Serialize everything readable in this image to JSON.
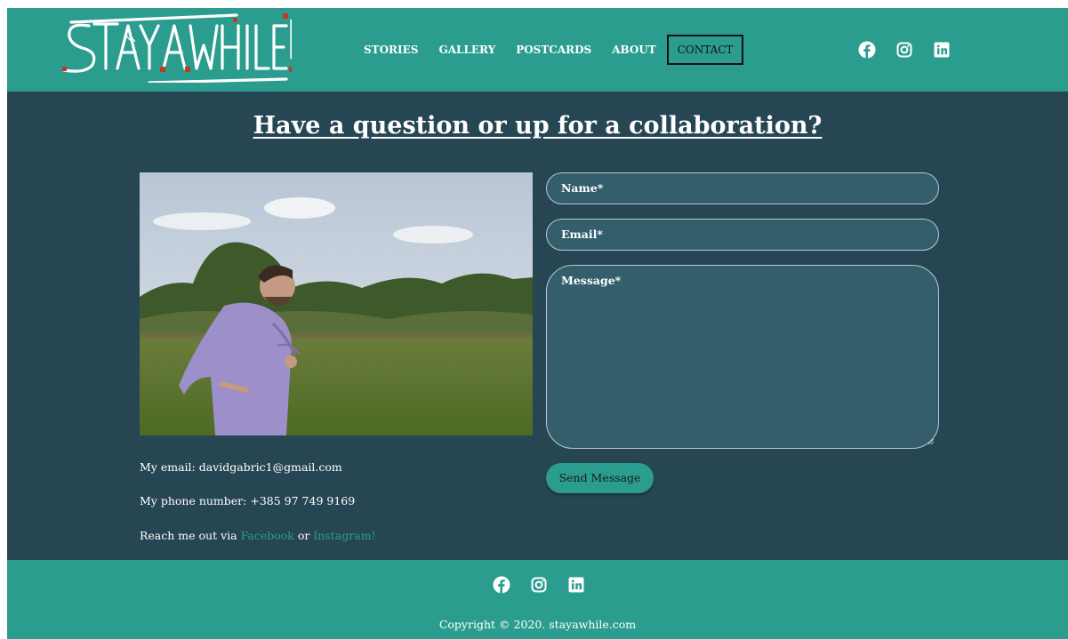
{
  "brand": {
    "logo_text": "STAY.A.WHILE!"
  },
  "nav": {
    "items": [
      "STORIES",
      "GALLERY",
      "POSTCARDS",
      "ABOUT"
    ],
    "active": "CONTACT"
  },
  "social_icons": [
    "facebook-icon",
    "instagram-icon",
    "linkedin-icon"
  ],
  "main": {
    "title": "Have a question or up for a collaboration?",
    "email_line": "My email: davidgabric1@gmail.com",
    "phone_line": "My phone number: +385 97 749 9169",
    "reach_prefix": "Reach me out via ",
    "reach_facebook": "Facebook",
    "reach_or": " or ",
    "reach_instagram": "Instagram!"
  },
  "form": {
    "name_placeholder": "Name*",
    "email_placeholder": "Email*",
    "message_placeholder": "Message*",
    "send_label": "Send Message"
  },
  "footer": {
    "copyright": "Copyright © 2020. stayawhile.com"
  },
  "colors": {
    "teal": "#2a9d8f",
    "dark": "#264653",
    "field": "#355e6d"
  }
}
